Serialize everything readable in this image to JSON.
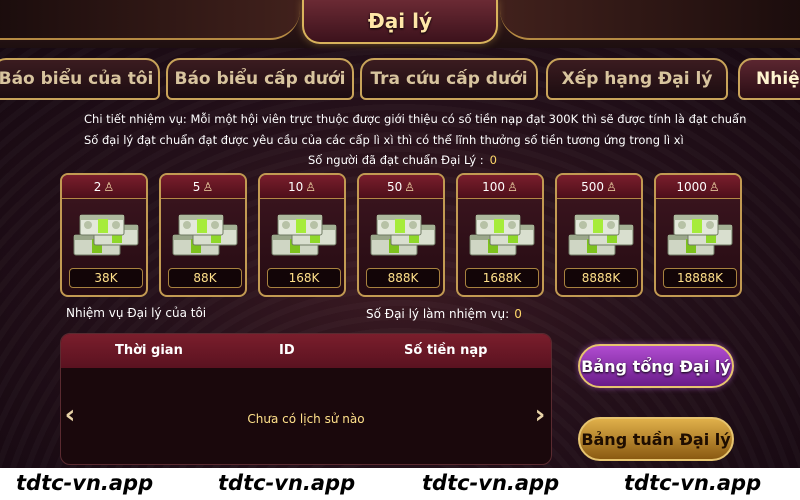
{
  "header": {
    "title": "Đại lý"
  },
  "tabs": [
    {
      "label": "Báo biểu của tôi"
    },
    {
      "label": "Báo biểu cấp dưới"
    },
    {
      "label": "Tra cứu cấp dưới"
    },
    {
      "label": "Xếp hạng Đại lý"
    },
    {
      "label": "Nhiệ"
    }
  ],
  "description": {
    "line1": "Chi tiết nhiệm vụ: Mỗi một hội viên trực thuộc được giới thiệu có số tiền nạp đạt 300K thì sẽ được tính là đạt chuẩn",
    "line2": "Số đại lý đạt chuẩn đạt được yêu cầu của các cấp lì xì thì có thể lĩnh thưởng số tiền tương ứng trong lì xì",
    "qualified_label": "Số người đã đạt chuẩn Đại Lý :",
    "qualified_count": "0"
  },
  "rewards": [
    {
      "people": "2",
      "amount": "38K"
    },
    {
      "people": "5",
      "amount": "88K"
    },
    {
      "people": "10",
      "amount": "168K"
    },
    {
      "people": "50",
      "amount": "888K"
    },
    {
      "people": "100",
      "amount": "1688K"
    },
    {
      "people": "500",
      "amount": "8888K"
    },
    {
      "people": "1000",
      "amount": "18888K"
    }
  ],
  "mission": {
    "my_label": "Nhiệm vụ Đại lý của tôi",
    "count_label": "Số Đại lý làm nhiệm vụ:",
    "count_value": "0"
  },
  "table": {
    "columns": [
      "Thời gian",
      "ID",
      "Số tiền nạp"
    ],
    "empty_message": "Chưa có lịch sử nào"
  },
  "buttons": {
    "total_ranking": "Bảng tổng Đại lý",
    "weekly_ranking": "Bảng tuần Đại lý"
  },
  "watermark": [
    "tdtc-vn.app",
    "tdtc-vn.app",
    "tdtc-vn.app",
    "tdtc-vn.app"
  ],
  "icons": {
    "person": "person-icon",
    "cash": "cash-stack-icon",
    "prev": "chevron-left-icon",
    "next": "chevron-right-icon"
  },
  "colors": {
    "gold_border": "#c9a45a",
    "card_header": "#7a1e2c",
    "amount_text": "#ffe08a",
    "purple_button": "#9a3cc0",
    "gold_button": "#d4a13e"
  }
}
